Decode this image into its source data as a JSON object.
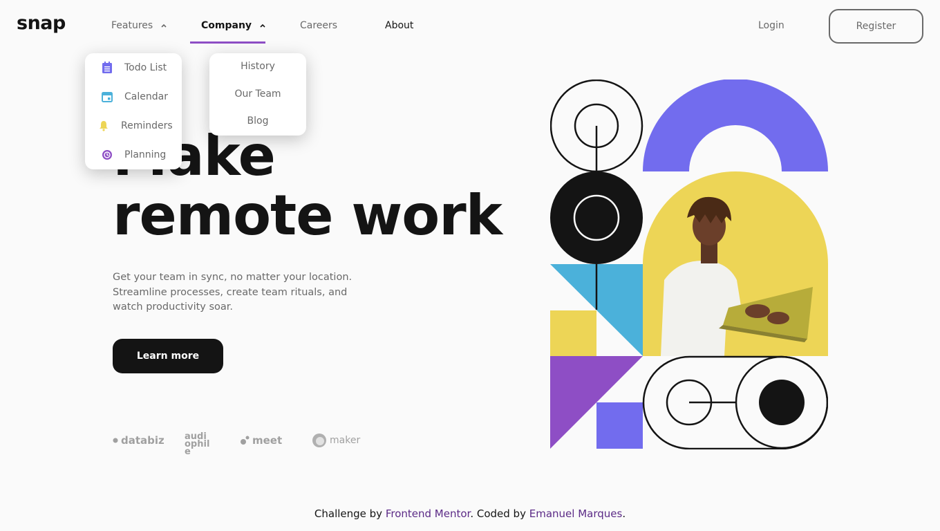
{
  "brand": {
    "logo": "snap"
  },
  "nav": {
    "features": "Features",
    "company": "Company",
    "careers": "Careers",
    "about": "About",
    "login": "Login",
    "register": "Register"
  },
  "features_menu": [
    {
      "label": "Todo List",
      "icon": "todo-list-icon",
      "color": "#726cee"
    },
    {
      "label": "Calendar",
      "icon": "calendar-icon",
      "color": "#4bb1da"
    },
    {
      "label": "Reminders",
      "icon": "bell-icon",
      "color": "#edd556"
    },
    {
      "label": "Planning",
      "icon": "planning-icon",
      "color": "#8e4ec5"
    }
  ],
  "company_menu": [
    "History",
    "Our Team",
    "Blog"
  ],
  "hero": {
    "title_line1": "Make",
    "title_line2": "remote work",
    "text": "Get your team in sync, no matter your location. Streamline processes, create team rituals, and watch productivity soar.",
    "cta": "Learn more"
  },
  "clients": [
    "databiz",
    "audiophile",
    "meet",
    "maker"
  ],
  "footer": {
    "prefix": "Challenge by ",
    "link1": "Frontend Mentor",
    "middle": ". Coded by ",
    "link2": "Emanuel Marques",
    "suffix": "."
  },
  "colors": {
    "accent_purple": "#8e4ec5",
    "violet": "#726cee",
    "blue": "#4bb1da",
    "yellow": "#edd556",
    "dark": "#141414",
    "gray": "#696969"
  }
}
